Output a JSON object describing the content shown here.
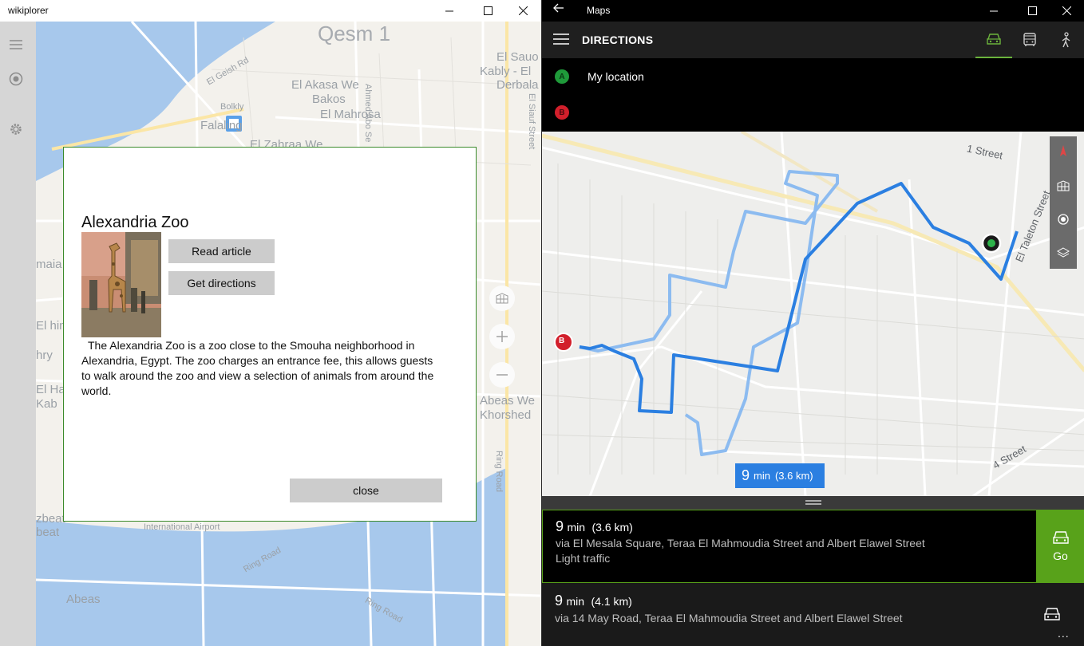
{
  "wikiplorer": {
    "window_title": "wikiplorer",
    "map_labels": {
      "qesm1": "Qesm 1",
      "el_sauo": "El Sauo",
      "kably": "Kably - El",
      "derbala": "Derbala",
      "el_akasa": "El Akasa We",
      "bakos": "Bakos",
      "bolkly": "Bolkly",
      "el_mahrosa": "El Mahrosa",
      "falaiing": "Falaling",
      "el_zahraa": "El Zahraa We",
      "ahmed_abo": "Ahmed Abo Se",
      "el_siauf": "El Siauf Street",
      "el_geish": "El Geish Rd",
      "maia": "maia",
      "elhima": "El\nhima",
      "ahry": "hry",
      "el_ha": "El Ha",
      "kab": "Kab",
      "abeas_we": "Abeas We",
      "khorshed": "Khorshed",
      "ring_road_v": "Ring Road",
      "zbeat": "zbeat",
      "beat": "beat",
      "intl_airport": "International Airport",
      "ring_road_a": "Ring Road",
      "abeas": "Abeas",
      "ring_road_b": "Ring Road"
    },
    "dialog": {
      "title": "Alexandria Zoo",
      "read_article": "Read article",
      "get_directions": "Get directions",
      "description": "The Alexandria Zoo is a zoo close to the Smouha neighborhood in Alexandria, Egypt. The zoo charges an entrance fee, this allows guests to walk around the zoo and view a selection of animals from around the world.",
      "close": "close"
    }
  },
  "maps": {
    "window_title": "Maps",
    "header_title": "DIRECTIONS",
    "waypoint_a_badge": "A",
    "waypoint_a": "My location",
    "waypoint_b_badge": "B",
    "map_labels": {
      "street1": "1 Street",
      "eltaleton": "El Taleton Street",
      "street4": "4 Street",
      "b_marker": "B"
    },
    "route_tag": {
      "minutes": "9",
      "min_label": "min",
      "distance": "(3.6 km)"
    },
    "routes": [
      {
        "minutes": "9",
        "min_label": "min",
        "distance": "(3.6 km)",
        "via": "via El Mesala Square, Teraa El Mahmoudia Street and Albert Elawel Street",
        "traffic": "Light traffic"
      },
      {
        "minutes": "9",
        "min_label": "min",
        "distance": "(4.1 km)",
        "via": "via 14 May Road, Teraa El Mahmoudia Street and Albert Elawel Street"
      }
    ],
    "go_label": "Go",
    "more_label": "..."
  },
  "colors": {
    "accent_green": "#58a21a",
    "route_blue": "#2b7fe1",
    "alt_route_blue": "#8cbbf0",
    "badge_a": "#1f9a3a",
    "badge_b": "#d21f2b"
  }
}
